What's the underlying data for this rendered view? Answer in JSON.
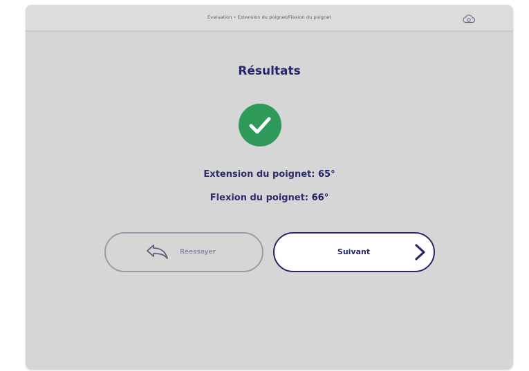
{
  "header": {
    "breadcrumb": "Évaluation • Extension du poignet/Flexion du poignet",
    "cloud_icon": "cloud-sync-icon"
  },
  "main": {
    "title": "Résultats",
    "status_icon": "check-circle-icon",
    "status_color": "#2d9a5a",
    "results": [
      {
        "label": "Extension du poignet:",
        "value": "65°"
      },
      {
        "label": "Flexion du poignet:",
        "value": "66°"
      }
    ]
  },
  "actions": {
    "retry": {
      "label": "Réessayer",
      "icon": "undo-arrow-icon"
    },
    "next": {
      "label": "Suivant",
      "icon": "chevron-right-icon"
    }
  },
  "colors": {
    "accent": "#26266a",
    "background": "#d6d6d6",
    "success": "#2d9a5a"
  }
}
